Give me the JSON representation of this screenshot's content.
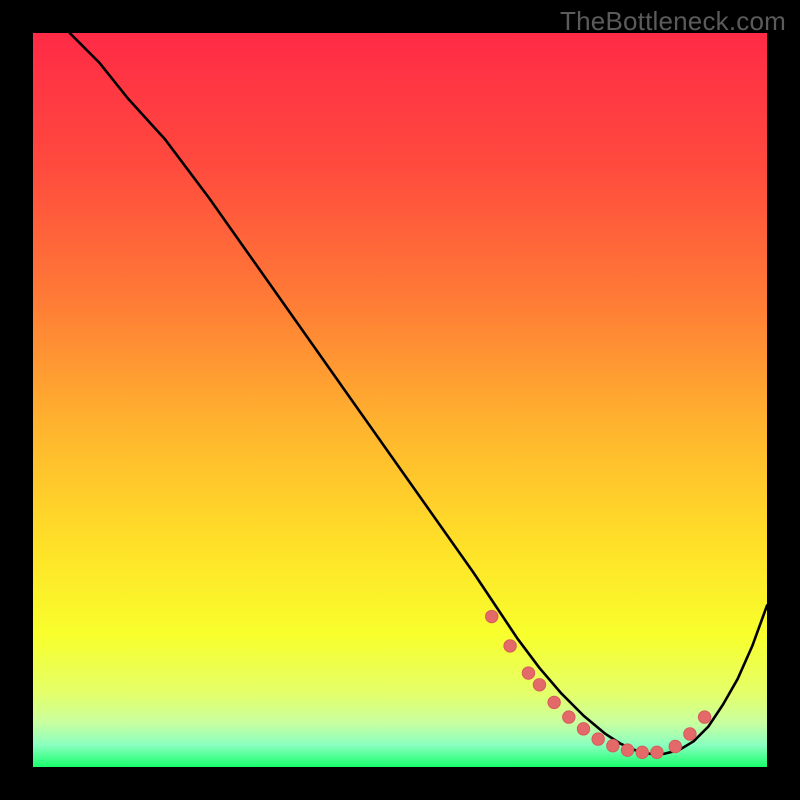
{
  "watermark": "TheBottleneck.com",
  "colors": {
    "page_bg": "#000000",
    "gradient_top": "#ff2a46",
    "gradient_mid1": "#ff6a3a",
    "gradient_mid2": "#ffb934",
    "gradient_mid3": "#ffe628",
    "gradient_mid4": "#f7ff2a",
    "gradient_band": "#dfff8a",
    "gradient_band2": "#b8ffb0",
    "gradient_bottom": "#18ff6b",
    "curve": "#000000",
    "marker_fill": "#e46a6a",
    "marker_stroke": "#d85a5a"
  },
  "chart_data": {
    "type": "line",
    "title": "",
    "xlabel": "",
    "ylabel": "",
    "xlim": [
      0,
      100
    ],
    "ylim": [
      0,
      100
    ],
    "grid": false,
    "legend": false,
    "series": [
      {
        "name": "curve",
        "x": [
          5,
          9,
          13,
          18,
          24,
          30,
          36,
          42,
          48,
          54,
          60,
          63,
          66,
          69,
          72,
          75,
          78,
          80,
          82,
          84,
          86,
          88,
          90,
          92,
          94,
          96,
          98,
          100
        ],
        "y": [
          100,
          96,
          91,
          85.5,
          77.5,
          69,
          60.5,
          52,
          43.5,
          35,
          26.5,
          22,
          17.5,
          13.5,
          10,
          7,
          4.5,
          3.2,
          2.3,
          1.8,
          1.8,
          2.3,
          3.5,
          5.5,
          8.5,
          12,
          16.5,
          22
        ]
      }
    ],
    "markers": {
      "name": "highlight-points",
      "x": [
        62.5,
        65,
        67.5,
        69,
        71,
        73,
        75,
        77,
        79,
        81,
        83,
        85,
        87.5,
        89.5,
        91.5
      ],
      "y": [
        20.5,
        16.5,
        12.8,
        11.2,
        8.8,
        6.8,
        5.2,
        3.8,
        2.9,
        2.3,
        2.0,
        2.0,
        2.8,
        4.5,
        6.8
      ]
    }
  }
}
